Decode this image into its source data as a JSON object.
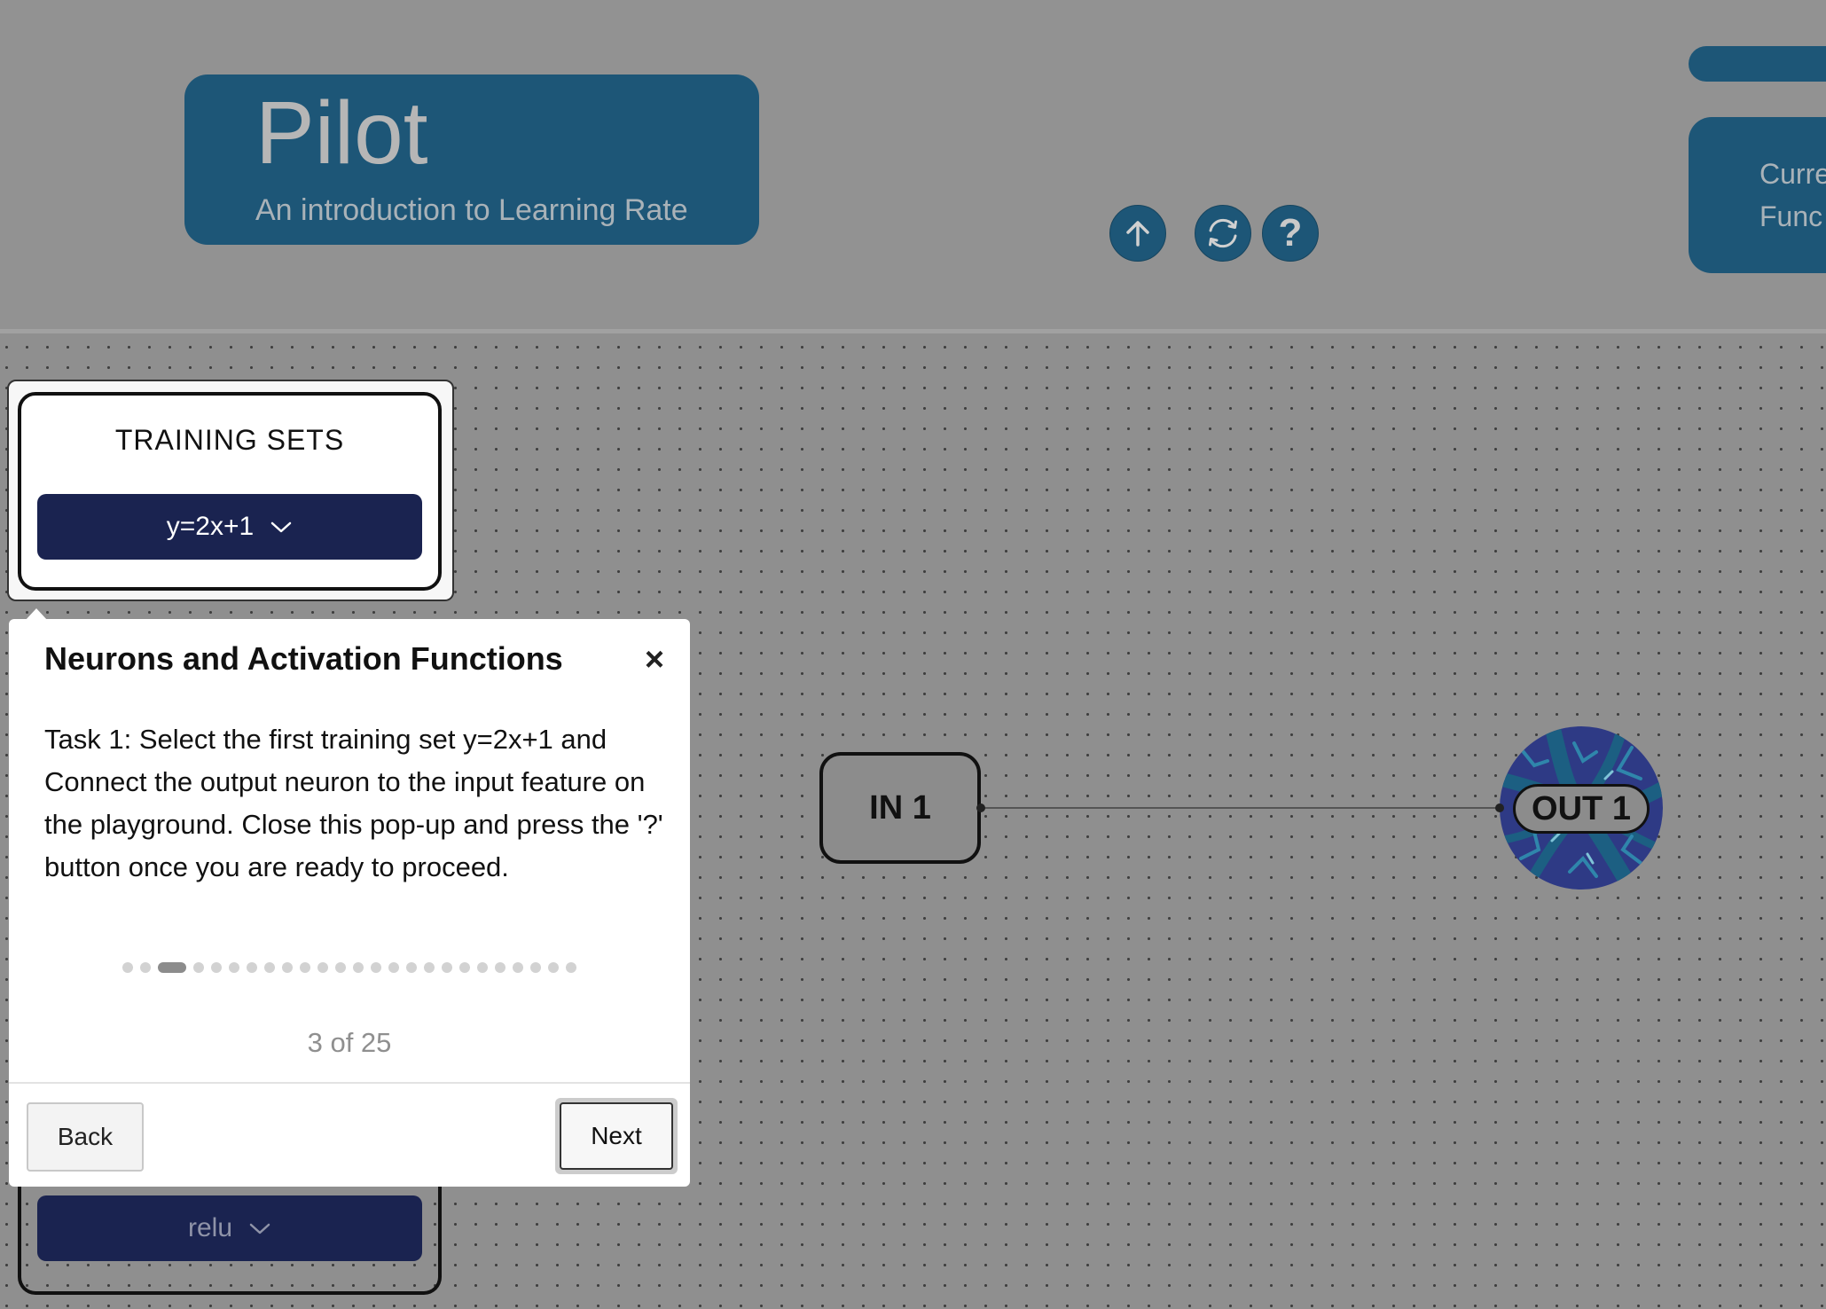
{
  "header": {
    "title": "Pilot",
    "subtitle": "An introduction to Learning Rate",
    "buttons": [
      {
        "icon": "arrow-up-icon"
      },
      {
        "icon": "refresh-icon"
      },
      {
        "icon": "question-icon",
        "label": "?"
      }
    ],
    "right_card_lines": [
      "Curre",
      "Func"
    ]
  },
  "training_panel": {
    "title": "TRAINING SETS",
    "selected": "y=2x+1"
  },
  "activation_panel": {
    "selected": "relu"
  },
  "popup": {
    "title": "Neurons and Activation Functions",
    "close_label": "×",
    "body": "Task 1: Select the first training set y=2x+1 and Connect the output neuron to the input feature on the playground. Close this pop-up and press the '?' button once you are ready to proceed.",
    "current_step": 3,
    "total_steps": 25,
    "counter": "3 of 25",
    "back_label": "Back",
    "next_label": "Next"
  },
  "playground": {
    "input_node": "IN 1",
    "output_node": "OUT 1"
  },
  "colors": {
    "header_card": "#1d5677",
    "select_bg": "#1a2350",
    "background": "#8f8f8f"
  }
}
